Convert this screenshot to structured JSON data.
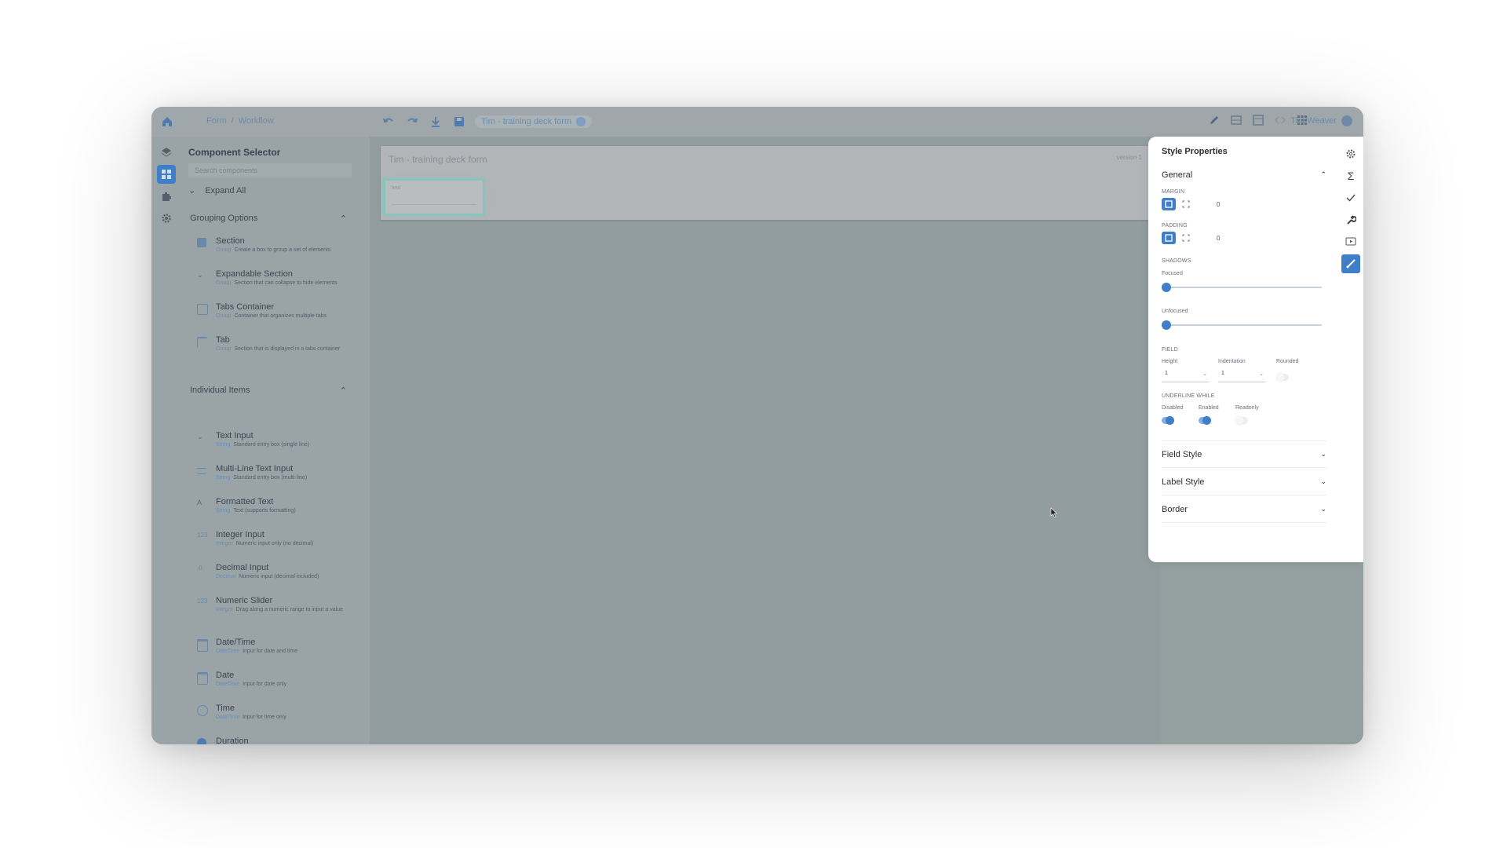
{
  "topbar": {
    "crumbs": [
      "Form",
      "/",
      "Workflow"
    ],
    "doc_name": "Tim - training deck form",
    "user": "Tim Weaver"
  },
  "component_selector": {
    "title": "Component Selector",
    "search_placeholder": "Search components",
    "expand_all": "Expand All",
    "grouping": {
      "title": "Grouping Options",
      "items": [
        {
          "name": "Section",
          "tag": "Group",
          "desc": "Create a box to group a set of elements"
        },
        {
          "name": "Expandable Section",
          "tag": "Group",
          "desc": "Section that can collapse to hide elements"
        },
        {
          "name": "Tabs Container",
          "tag": "Group",
          "desc": "Container that organizes multiple tabs"
        },
        {
          "name": "Tab",
          "tag": "Group",
          "desc": "Section that is displayed in a tabs container"
        }
      ]
    },
    "individual": {
      "title": "Individual Items",
      "items": [
        {
          "name": "Text Input",
          "tag": "String",
          "desc": "Standard entry box (single line)"
        },
        {
          "name": "Multi-Line Text Input",
          "tag": "String",
          "desc": "Standard entry box (multi-line)"
        },
        {
          "name": "Formatted Text",
          "tag": "String",
          "desc": "Text (supports formatting)"
        },
        {
          "name": "Integer Input",
          "tag": "Integer",
          "desc": "Numeric input only (no decimal)"
        },
        {
          "name": "Decimal Input",
          "tag": "Decimal",
          "desc": "Numeric input (decimal included)"
        },
        {
          "name": "Numeric Slider",
          "tag": "Integer",
          "desc": "Drag along a numeric range to input a value"
        },
        {
          "name": "Date/Time",
          "tag": "DateTime",
          "desc": "Input for date and time"
        },
        {
          "name": "Date",
          "tag": "DateTime",
          "desc": "Input for date only"
        },
        {
          "name": "Time",
          "tag": "DateTime",
          "desc": "Input for time only"
        },
        {
          "name": "Duration",
          "tag": "",
          "desc": ""
        }
      ]
    }
  },
  "canvas": {
    "form_title": "Tim - training deck form",
    "version": "version 1",
    "field_label": "test"
  },
  "style_properties": {
    "title": "Style Properties",
    "general": {
      "title": "General",
      "margin_label": "MARGIN",
      "margin_value": "0",
      "padding_label": "PADDING",
      "padding_value": "0",
      "shadows_label": "SHADOWS",
      "focused_label": "Focused",
      "focused_value": 0,
      "unfocused_label": "Unfocused",
      "unfocused_value": 0,
      "field_label": "FIELD",
      "height_label": "Height",
      "height_value": "1",
      "indentation_label": "Indentation",
      "indentation_value": "1",
      "rounded_label": "Rounded",
      "underline_label": "UNDERLINE WHILE",
      "disabled_label": "Disabled",
      "enabled_label": "Enabled",
      "readonly_label": "Readonly"
    },
    "sections": [
      "Field Style",
      "Label Style",
      "Border"
    ]
  },
  "colors": {
    "accent": "#3f7fc9",
    "overlay": "#949fa0",
    "focus_glow": "#6ecdc3"
  }
}
